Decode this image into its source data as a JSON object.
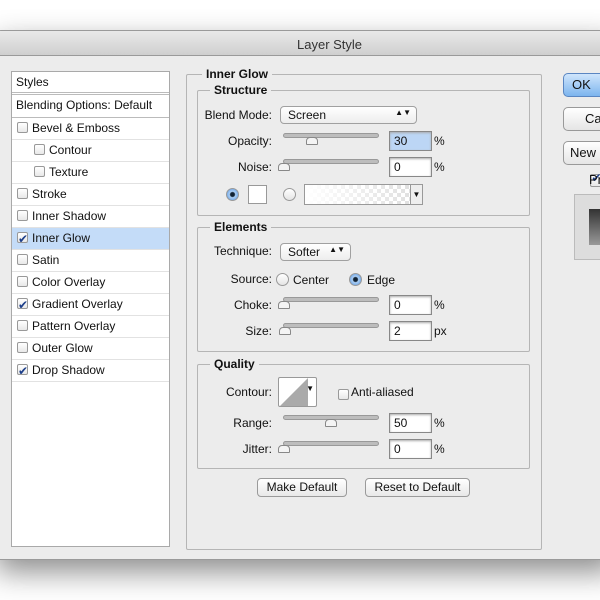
{
  "window": {
    "title": "Layer Style"
  },
  "styles": {
    "header": "Styles",
    "blending": "Blending Options: Default",
    "items": [
      {
        "label": "Bevel & Emboss",
        "checked": false,
        "indent": false
      },
      {
        "label": "Contour",
        "checked": false,
        "indent": true
      },
      {
        "label": "Texture",
        "checked": false,
        "indent": true
      },
      {
        "label": "Stroke",
        "checked": false,
        "indent": false
      },
      {
        "label": "Inner Shadow",
        "checked": false,
        "indent": false
      },
      {
        "label": "Inner Glow",
        "checked": true,
        "indent": false,
        "selected": true
      },
      {
        "label": "Satin",
        "checked": false,
        "indent": false
      },
      {
        "label": "Color Overlay",
        "checked": false,
        "indent": false
      },
      {
        "label": "Gradient Overlay",
        "checked": true,
        "indent": false
      },
      {
        "label": "Pattern Overlay",
        "checked": false,
        "indent": false
      },
      {
        "label": "Outer Glow",
        "checked": false,
        "indent": false
      },
      {
        "label": "Drop Shadow",
        "checked": true,
        "indent": false
      }
    ]
  },
  "inner_glow": {
    "title": "Inner Glow",
    "structure": {
      "title": "Structure",
      "blend_mode_label": "Blend Mode:",
      "blend_mode": "Screen",
      "opacity_label": "Opacity:",
      "opacity": "30",
      "noise_label": "Noise:",
      "noise": "0",
      "unit": "%",
      "color_mode": "solid"
    },
    "elements": {
      "title": "Elements",
      "technique_label": "Technique:",
      "technique": "Softer",
      "source_label": "Source:",
      "source_center": "Center",
      "source_edge": "Edge",
      "source_selected": "Edge",
      "choke_label": "Choke:",
      "choke": "0",
      "choke_unit": "%",
      "size_label": "Size:",
      "size": "2",
      "size_unit": "px"
    },
    "quality": {
      "title": "Quality",
      "contour_label": "Contour:",
      "anti_aliased": "Anti-aliased",
      "anti_aliased_checked": false,
      "range_label": "Range:",
      "range": "50",
      "jitter_label": "Jitter:",
      "jitter": "0",
      "unit": "%"
    },
    "make_default": "Make Default",
    "reset_default": "Reset to Default"
  },
  "right": {
    "ok": "OK",
    "cancel": "Cancel",
    "new_style": "New Style...",
    "preview": "Preview",
    "preview_checked": true
  }
}
